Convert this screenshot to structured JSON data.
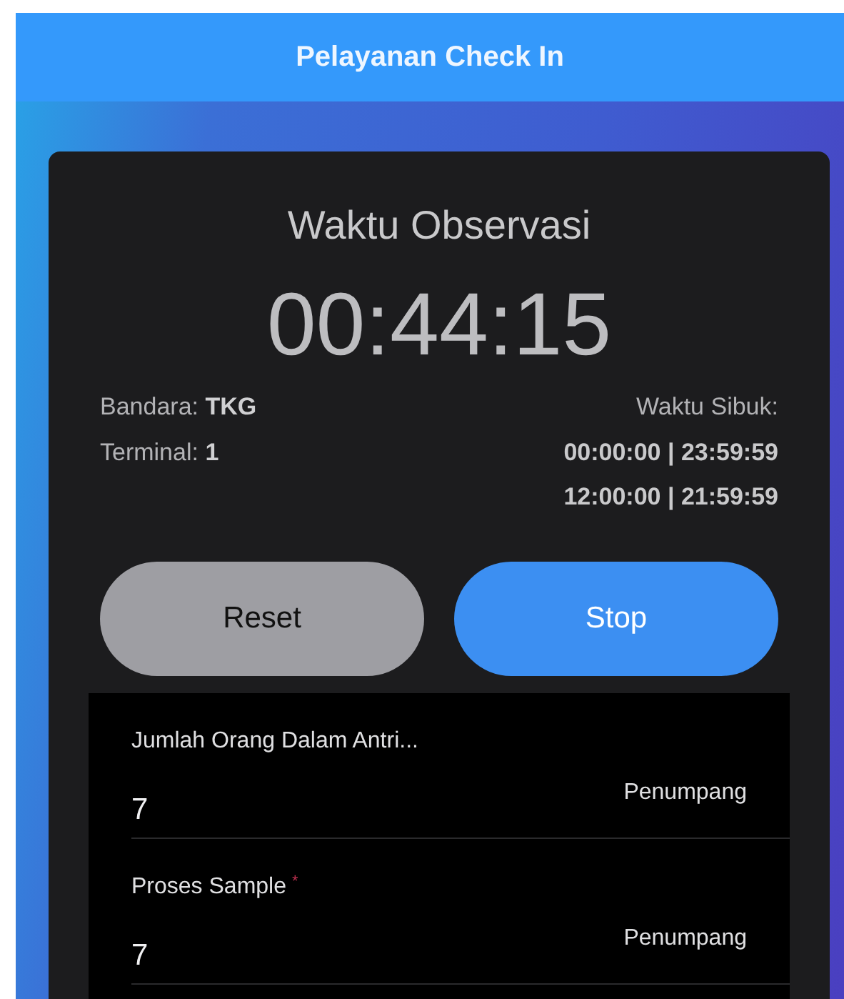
{
  "header": {
    "title": "Pelayanan Check In"
  },
  "card": {
    "title": "Waktu Observasi",
    "timer": "00:44:15",
    "info_left": [
      {
        "label": "Bandara:",
        "value": "TKG"
      },
      {
        "label": "Terminal:",
        "value": "1"
      }
    ],
    "busy_label": "Waktu Sibuk:",
    "busy_ranges": [
      "00:00:00 | 23:59:59",
      "12:00:00 | 21:59:59"
    ],
    "buttons": [
      {
        "label": "Reset",
        "kind": "secondary"
      },
      {
        "label": "Stop",
        "kind": "primary"
      }
    ]
  },
  "fields": [
    {
      "label": "Jumlah Orang Dalam Antri...",
      "value": "7",
      "unit": "Penumpang"
    },
    {
      "label": "Proses Sample",
      "required_mark": "*",
      "value": "7",
      "unit": "Penumpang"
    }
  ]
}
